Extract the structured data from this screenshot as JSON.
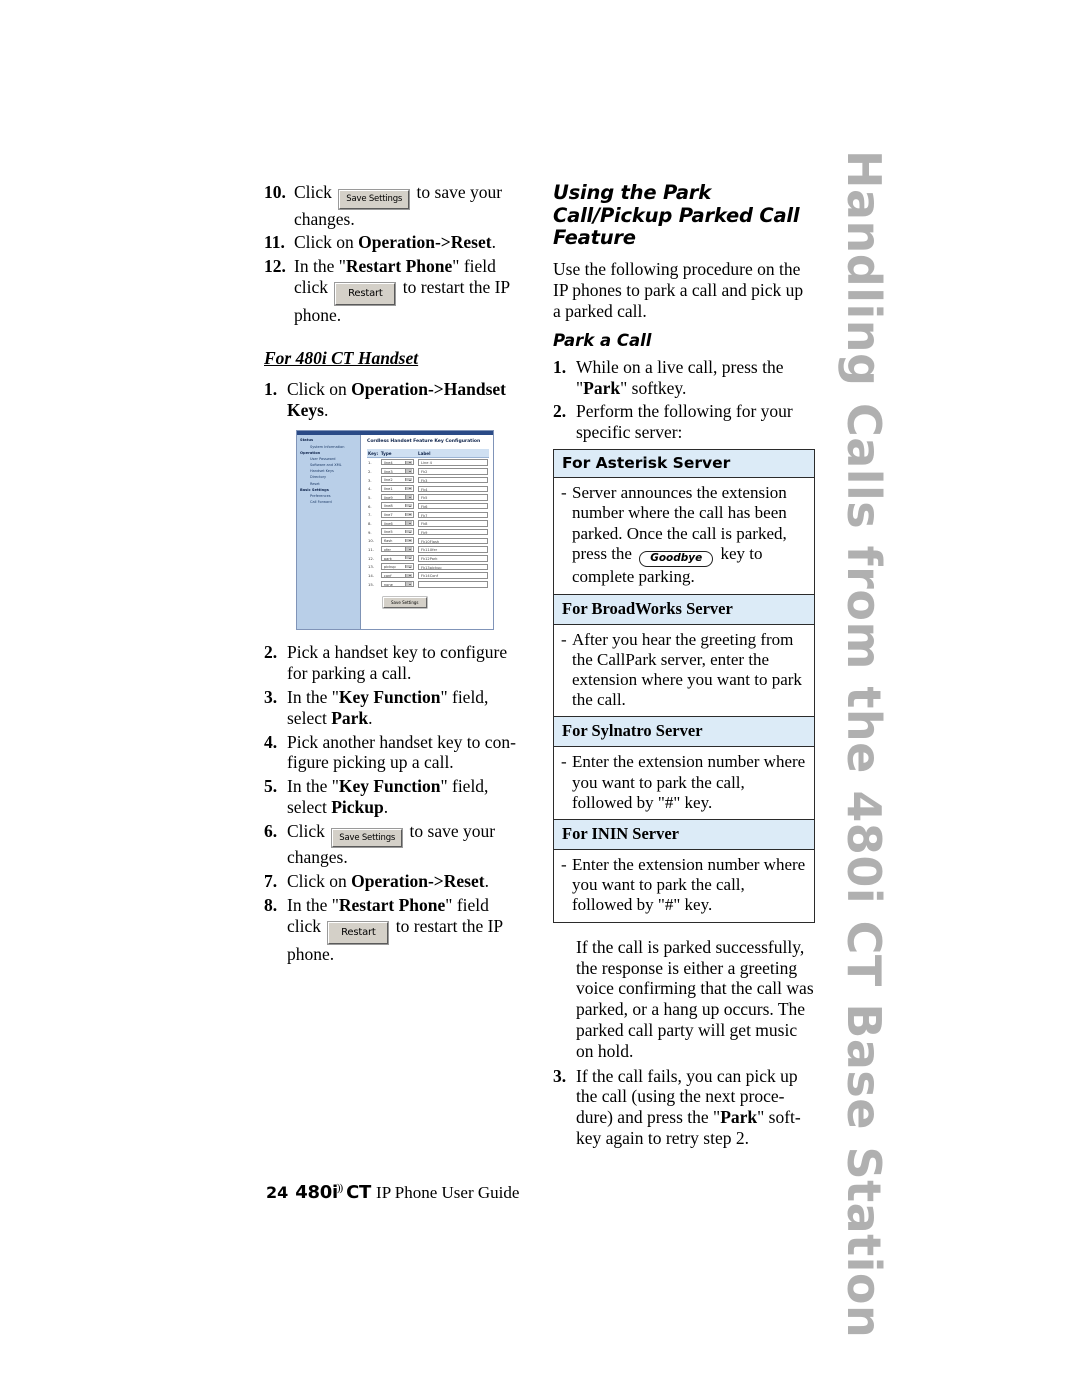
{
  "tab": {
    "vertical_label": "Handling Calls from the 480i CT Base Station"
  },
  "left_column": {
    "steps_top": [
      {
        "num": "10.",
        "text_before": "Click ",
        "button": "Save Settings",
        "text_after": " to save your changes."
      },
      {
        "num": "11.",
        "text": "Click on Operation->Reset."
      },
      {
        "num": "12.",
        "text_before": "In the \"Restart Phone\" field click ",
        "button": "Restart",
        "text_after": " to restart the IP phone."
      }
    ],
    "handset_heading": "For 480i CT Handset",
    "step1": {
      "num": "1.",
      "text": "Click on Operation->Handset Keys."
    },
    "screenshot": {
      "title": "Cordless Handset Feature Key Configuration",
      "sidebar": [
        {
          "type": "group",
          "label": "Status"
        },
        {
          "type": "item",
          "label": "System Information"
        },
        {
          "type": "group",
          "label": "Operation"
        },
        {
          "type": "item",
          "label": "User Password"
        },
        {
          "type": "item",
          "label": "Software and XML"
        },
        {
          "type": "item",
          "label": "Handset Keys"
        },
        {
          "type": "item",
          "label": "Directory"
        },
        {
          "type": "item",
          "label": "Reset"
        },
        {
          "type": "group",
          "label": "Basic Settings"
        },
        {
          "type": "item",
          "label": "Preferences"
        },
        {
          "type": "item",
          "label": "Call Forward"
        }
      ],
      "columns": [
        "Key:",
        "Type",
        "Label"
      ],
      "rows": [
        {
          "key": "1.",
          "type": "line4",
          "label": "Line 4"
        },
        {
          "key": "2.",
          "type": "line3",
          "label": "Fk2"
        },
        {
          "key": "3.",
          "type": "line2",
          "label": "Fk3"
        },
        {
          "key": "4.",
          "type": "line1",
          "label": "Fk4"
        },
        {
          "key": "5.",
          "type": "line9",
          "label": "Fk5"
        },
        {
          "key": "6.",
          "type": "line8",
          "label": "Fk6"
        },
        {
          "key": "7.",
          "type": "line7",
          "label": "Fk7"
        },
        {
          "key": "8.",
          "type": "line6",
          "label": "Fk8"
        },
        {
          "key": "9.",
          "type": "line5",
          "label": "Fk9"
        },
        {
          "key": "10.",
          "type": "flash",
          "label": "Fk10Flash"
        },
        {
          "key": "11.",
          "type": "xfer",
          "label": "Fk11Xfer"
        },
        {
          "key": "12.",
          "type": "park",
          "label": "Fk12Park"
        },
        {
          "key": "13.",
          "type": "pickup",
          "label": "Fk13pickup"
        },
        {
          "key": "14.",
          "type": "conf",
          "label": "Fk14Conf"
        },
        {
          "key": "15.",
          "type": "none",
          "label": ""
        }
      ],
      "save_button": "Save Settings"
    },
    "steps_bottom": [
      {
        "num": "2.",
        "text": "Pick a handset key to configure for parking a call."
      },
      {
        "num": "3.",
        "text": "In the \"Key Function\" field, select Park."
      },
      {
        "num": "4.",
        "text": "Pick another handset key to configure picking up a call."
      },
      {
        "num": "5.",
        "text": "In the \"Key Function\" field, select Pickup."
      },
      {
        "num": "6.",
        "text_before": "Click ",
        "button": "Save Settings",
        "text_after": " to save your changes."
      },
      {
        "num": "7.",
        "text": "Click on Operation->Reset."
      },
      {
        "num": "8.",
        "text_before": "In the \"Restart Phone\" field click ",
        "button": "Restart",
        "text_after": " to restart the IP phone."
      }
    ]
  },
  "right_column": {
    "heading": "Using the Park Call/Pickup Parked Call Feature",
    "intro": "Use the following procedure on the IP phones to park a call and pick up a parked call.",
    "subheading": "Park a Call",
    "step1": {
      "num": "1.",
      "text": "While on a live call, press the \"Park\" softkey."
    },
    "step2": {
      "num": "2.",
      "text": "Perform the following for your specific server:"
    },
    "servers": [
      {
        "header": "For Asterisk Server",
        "header_font": "sans",
        "body_before": "Server announces the extension number where the call has been parked. Once the call is parked, press the ",
        "button": "Goodbye",
        "body_after": " key to complete parking."
      },
      {
        "header": "For BroadWorks Server",
        "header_font": "serif",
        "body": "After you hear the greeting from the CallPark server, enter the extension where you want to park the call."
      },
      {
        "header": "For Sylnatro Server",
        "header_font": "serif",
        "body": "Enter the extension number where you want to park the call, followed by \"#\" key."
      },
      {
        "header": "For ININ Server",
        "header_font": "serif",
        "body": "Enter the extension number where you want to park the call, followed by \"#\" key."
      }
    ],
    "note": "If the call is parked successfully, the response is either a greeting voice confirming that the call was parked, or a hang up occurs. The parked call party will get music on hold.",
    "step3": {
      "num": "3.",
      "text": "If the call fails, you can pick up the call (using the next procedure) and press the \"Park\" softkey again to retry step 2."
    }
  },
  "footer": {
    "page_number": "24",
    "model": "480i",
    "wireless_glyph": "))",
    "model_suffix": "CT",
    "guide_text": "IP Phone User Guide"
  },
  "colors": {
    "tab_text": "#b0b0b0",
    "server_header_bg": "#dcebf7",
    "screenshot_sidebar_bg": "#b9cfe8",
    "screenshot_titlebar": "#2a4a86"
  }
}
